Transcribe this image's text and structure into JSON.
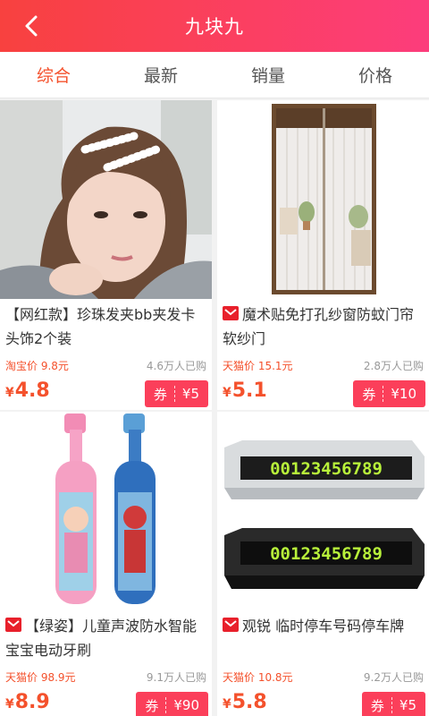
{
  "header": {
    "title": "九块九",
    "back_icon": "back-arrow-icon"
  },
  "tabs": [
    {
      "label": "综合",
      "active": true
    },
    {
      "label": "最新",
      "active": false
    },
    {
      "label": "销量",
      "active": false
    },
    {
      "label": "价格",
      "active": false
    }
  ],
  "products": [
    {
      "name": "【网红款】珍珠发夹bb夹发卡头饰2个装",
      "source_icon": false,
      "orig_price": "淘宝价 9.8元",
      "sold": "4.6万人已购",
      "price_symbol": "¥",
      "price": "4.8",
      "coupon_label": "券",
      "coupon_value": "¥5",
      "image": "pearl-hair-clip-model"
    },
    {
      "name": "魔术贴免打孔纱窗防蚊门帘软纱门",
      "source_icon": true,
      "orig_price": "天猫价 15.1元",
      "sold": "2.8万人已购",
      "price_symbol": "¥",
      "price": "5.1",
      "coupon_label": "券",
      "coupon_value": "¥10",
      "image": "mosquito-door-curtain"
    },
    {
      "name": "【绿姿】儿童声波防水智能宝宝电动牙刷",
      "source_icon": true,
      "orig_price": "天猫价 98.9元",
      "sold": "9.1万人已购",
      "price_symbol": "¥",
      "price": "8.9",
      "coupon_label": "券",
      "coupon_value": "¥90",
      "image": "kids-electric-toothbrush"
    },
    {
      "name": "观锐 临时停车号码停车牌",
      "source_icon": true,
      "orig_price": "天猫价 10.8元",
      "sold": "9.2万人已购",
      "price_symbol": "¥",
      "price": "5.8",
      "coupon_label": "券",
      "coupon_value": "¥5",
      "image": "parking-number-plate",
      "plate_number": "00123456789"
    }
  ],
  "colors": {
    "accent": "#f4512c",
    "header_start": "#f8413f",
    "header_end": "#fc3d7c",
    "coupon": "#fb3f5a"
  }
}
